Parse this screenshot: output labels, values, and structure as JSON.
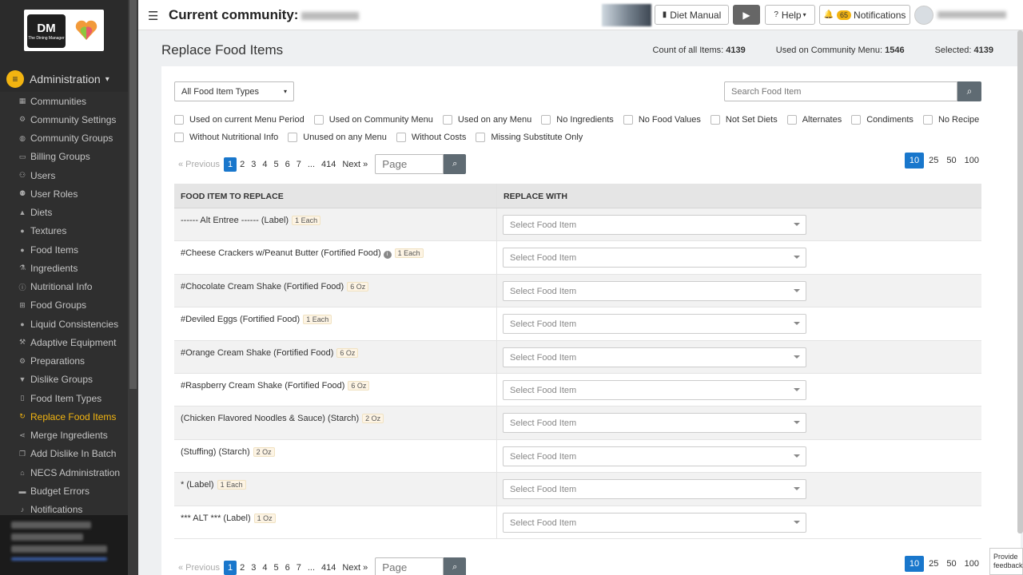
{
  "sidebar": {
    "logo_text": "DM",
    "logo_tagline": "The Dining Manager",
    "admin_label": "Administration",
    "items": [
      {
        "label": "Communities",
        "icon": "list-icon"
      },
      {
        "label": "Community Settings",
        "icon": "gear-icon"
      },
      {
        "label": "Community Groups",
        "icon": "globe-icon"
      },
      {
        "label": "Billing Groups",
        "icon": "card-icon"
      },
      {
        "label": "Users",
        "icon": "users-icon"
      },
      {
        "label": "User Roles",
        "icon": "user-tag-icon"
      },
      {
        "label": "Diets",
        "icon": "warning-icon"
      },
      {
        "label": "Textures",
        "icon": "drop-icon"
      },
      {
        "label": "Food Items",
        "icon": "apple-icon"
      },
      {
        "label": "Ingredients",
        "icon": "flask-icon"
      },
      {
        "label": "Nutritional Info",
        "icon": "info-icon"
      },
      {
        "label": "Food Groups",
        "icon": "sitemap-icon"
      },
      {
        "label": "Liquid Consistencies",
        "icon": "drop-icon"
      },
      {
        "label": "Adaptive Equipment",
        "icon": "utensils-icon"
      },
      {
        "label": "Preparations",
        "icon": "cogs-icon"
      },
      {
        "label": "Dislike Groups",
        "icon": "thumbs-down-icon"
      },
      {
        "label": "Food Item Types",
        "icon": "file-icon"
      },
      {
        "label": "Replace Food Items",
        "icon": "sync-icon",
        "active": true
      },
      {
        "label": "Merge Ingredients",
        "icon": "share-icon"
      },
      {
        "label": "Add Dislike In Batch",
        "icon": "copy-icon"
      },
      {
        "label": "NECS Administration",
        "icon": "institution-icon"
      },
      {
        "label": "Budget Errors",
        "icon": "money-icon"
      },
      {
        "label": "Notifications",
        "icon": "bell-icon"
      }
    ]
  },
  "topbar": {
    "title_prefix": "Current community:",
    "diet_manual_label": "Diet Manual",
    "help_label": "Help",
    "notifications_count": "65",
    "notifications_label": "Notifications"
  },
  "page": {
    "title": "Replace Food Items",
    "count_all_label": "Count of all Items:",
    "count_all_value": "4139",
    "used_label": "Used on Community Menu:",
    "used_value": "1546",
    "selected_label": "Selected:",
    "selected_value": "4139"
  },
  "filters": {
    "type_select": "All Food Item Types",
    "search_placeholder": "Search Food Item",
    "row1": [
      "Used on current Menu Period",
      "Used on Community Menu",
      "Used on any Menu",
      "No Ingredients",
      "No Food Values",
      "Not Set Diets",
      "Alternates",
      "Condiments",
      "No Recipe"
    ],
    "row2": [
      "Without Nutritional Info",
      "Unused on any Menu",
      "Without Costs",
      "Missing Substitute Only"
    ]
  },
  "pagination": {
    "prev": "« Previous",
    "pages": [
      "1",
      "2",
      "3",
      "4",
      "5",
      "6",
      "7",
      "...",
      "414"
    ],
    "next": "Next »",
    "page_placeholder": "Page",
    "per_page": [
      "10",
      "25",
      "50",
      "100"
    ]
  },
  "table": {
    "col1": "FOOD ITEM TO REPLACE",
    "col2": "REPLACE WITH",
    "select_placeholder": "Select Food Item",
    "rows": [
      {
        "name": "------ Alt Entree ------ (Label)",
        "unit": "1 Each"
      },
      {
        "name": "#Cheese Crackers w/Peanut Butter (Fortified Food)",
        "unit": "1 Each",
        "info": true
      },
      {
        "name": "#Chocolate Cream Shake (Fortified Food)",
        "unit": "6 Oz"
      },
      {
        "name": "#Deviled Eggs (Fortified Food)",
        "unit": "1 Each"
      },
      {
        "name": "#Orange Cream Shake (Fortified Food)",
        "unit": "6 Oz"
      },
      {
        "name": "#Raspberry Cream Shake (Fortified Food)",
        "unit": "6 Oz"
      },
      {
        "name": "(Chicken Flavored Noodles & Sauce) (Starch)",
        "unit": "2 Oz"
      },
      {
        "name": "(Stuffing) (Starch)",
        "unit": "2 Oz"
      },
      {
        "name": "* (Label)",
        "unit": "1 Each"
      },
      {
        "name": "*** ALT *** (Label)",
        "unit": "1 Oz"
      }
    ]
  },
  "feedback_label": "Provide feedback",
  "colors": {
    "accent": "#f2b411",
    "primary": "#1977cc",
    "sidebar": "#2b2b2b"
  }
}
